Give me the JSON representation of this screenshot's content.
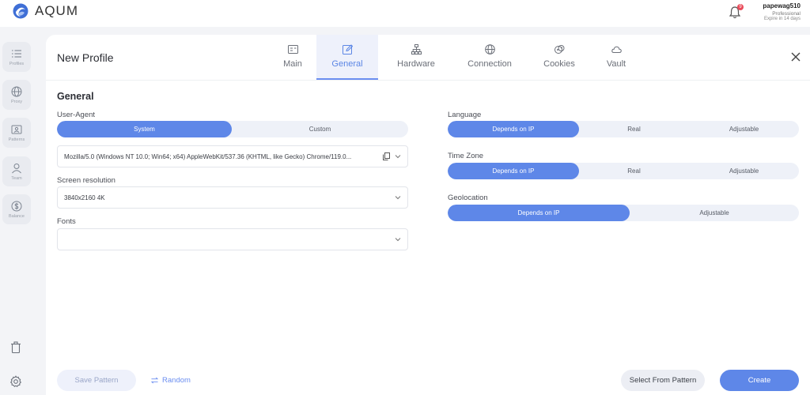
{
  "app": {
    "name": "AQUM"
  },
  "notifications": {
    "count": "9"
  },
  "user": {
    "name": "papewag510",
    "plan": "Professional",
    "expire": "Expire in 14 days"
  },
  "sidebar": {
    "items": [
      {
        "label": "Profiles",
        "icon": "list-icon"
      },
      {
        "label": "Proxy",
        "icon": "globe-icon"
      },
      {
        "label": "Patterns",
        "icon": "id-card-icon"
      },
      {
        "label": "Team",
        "icon": "user-icon"
      },
      {
        "label": "Balance",
        "icon": "dollar-icon"
      }
    ],
    "bottom": [
      "trash-icon",
      "gear-icon"
    ]
  },
  "panel": {
    "title": "New Profile",
    "tabs": [
      {
        "label": "Main",
        "icon": "id-card-icon",
        "active": false
      },
      {
        "label": "General",
        "icon": "edit-icon",
        "active": true
      },
      {
        "label": "Hardware",
        "icon": "network-icon",
        "active": false
      },
      {
        "label": "Connection",
        "icon": "globe-icon",
        "active": false
      },
      {
        "label": "Cookies",
        "icon": "cookie-icon",
        "active": false
      },
      {
        "label": "Vault",
        "icon": "cloud-icon",
        "active": false
      }
    ]
  },
  "general": {
    "title": "General",
    "user_agent": {
      "label": "User-Agent",
      "options": [
        "System",
        "Custom"
      ],
      "selected": "System",
      "value": "Mozilla/5.0 (Windows NT 10.0; Win64; x64) AppleWebKit/537.36 (KHTML, like Gecko) Chrome/119.0..."
    },
    "screen_resolution": {
      "label": "Screen resolution",
      "value": "3840x2160 4K"
    },
    "fonts": {
      "label": "Fonts",
      "value": ""
    },
    "language": {
      "label": "Language",
      "options": [
        "Depends on IP",
        "Real",
        "Adjustable"
      ],
      "selected": "Depends on IP"
    },
    "time_zone": {
      "label": "Time Zone",
      "options": [
        "Depends on IP",
        "Real",
        "Adjustable"
      ],
      "selected": "Depends on IP"
    },
    "geolocation": {
      "label": "Geolocation",
      "options": [
        "Depends on IP",
        "Adjustable"
      ],
      "selected": "Depends on IP"
    }
  },
  "footer": {
    "save_pattern": "Save Pattern",
    "random": "Random",
    "select_from_pattern": "Select From Pattern",
    "create": "Create"
  },
  "colors": {
    "accent": "#5e87e8",
    "badge": "#e94b5a"
  }
}
